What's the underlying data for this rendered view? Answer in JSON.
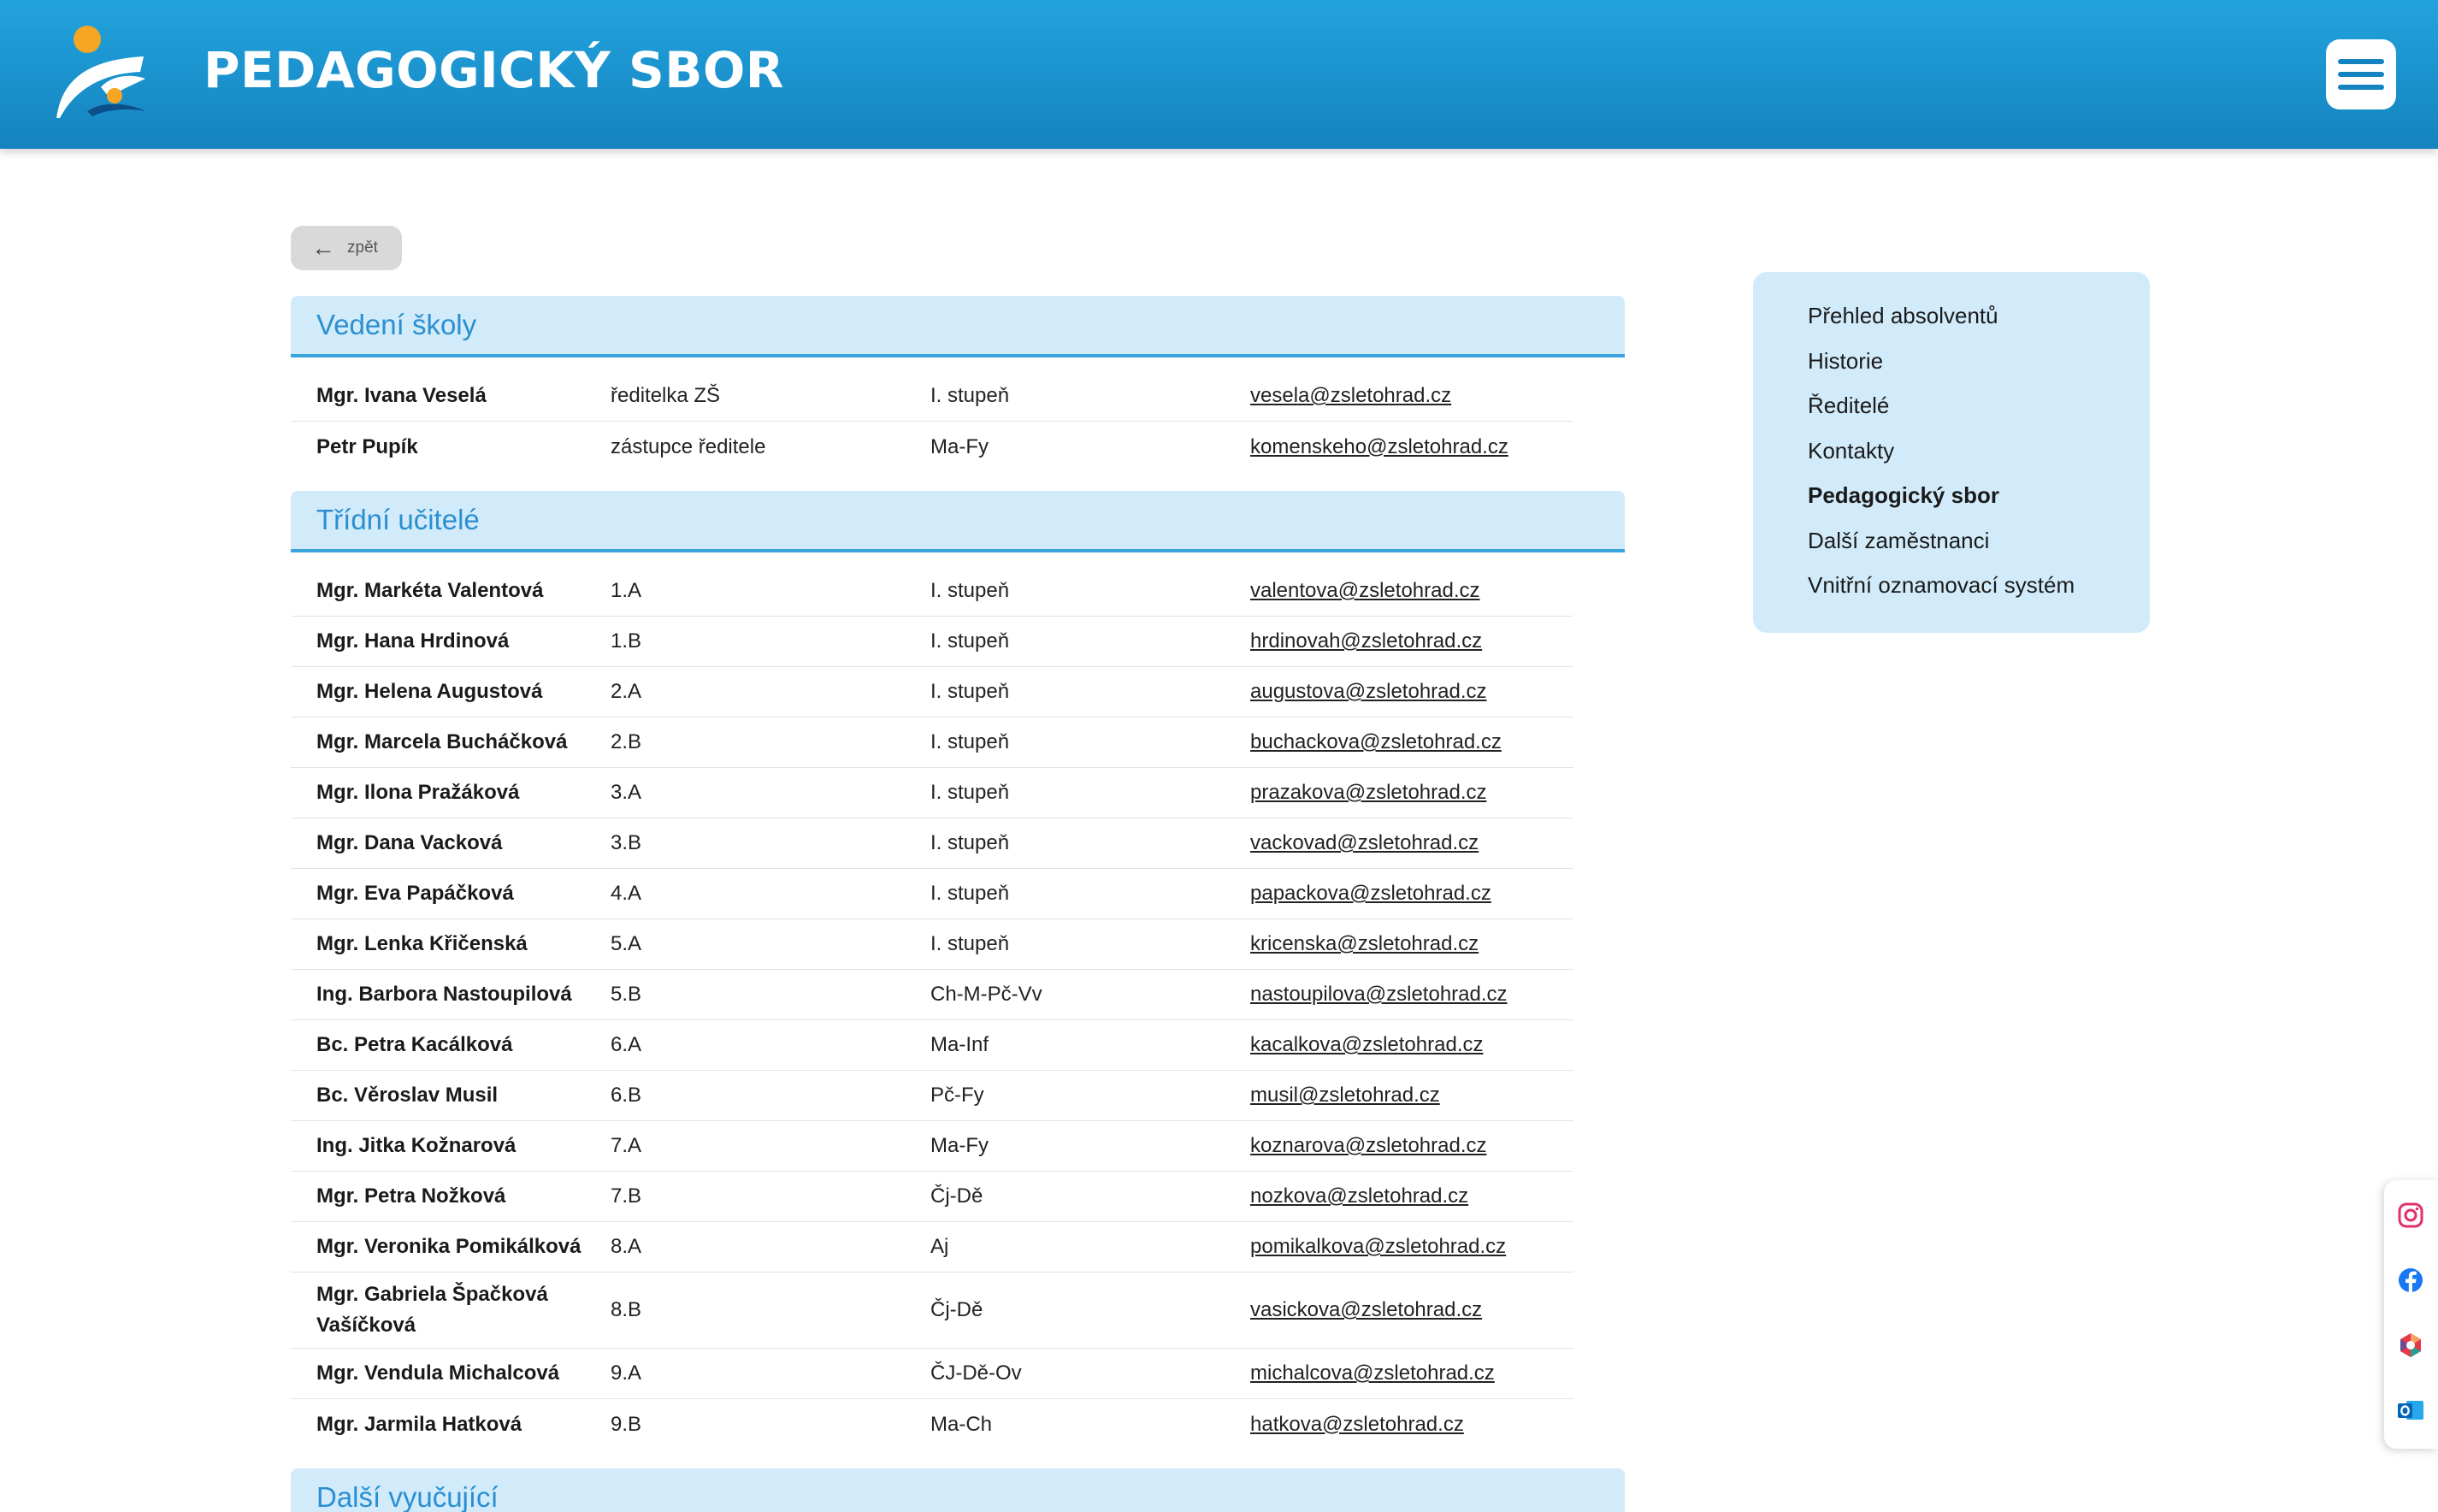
{
  "header": {
    "title": "PEDAGOGICKÝ SBOR",
    "colors": {
      "background": "#1b95d3",
      "logo_orange": "#f5a623",
      "logo_blue": "#1a6fb5"
    }
  },
  "back_button": {
    "label": "zpět"
  },
  "sections": [
    {
      "title": "Vedení školy",
      "rows": [
        {
          "name": "Mgr. Ivana Veselá",
          "role": "ředitelka ZŠ",
          "subject": " I. stupeň",
          "email": "vesela@zsletohrad.cz"
        },
        {
          "name": "Petr Pupík",
          "role": "zástupce ředitele",
          "subject": "Ma-Fy",
          "email": "komenskeho@zsletohrad.cz"
        }
      ]
    },
    {
      "title": "Třídní učitelé",
      "rows": [
        {
          "name": "Mgr. Markéta Valentová",
          "role": "1.A",
          "subject": "I. stupeň",
          "email": "valentova@zsletohrad.cz"
        },
        {
          "name": "Mgr. Hana Hrdinová",
          "role": "1.B",
          "subject": "I. stupeň",
          "email": "hrdinovah@zsletohrad.cz"
        },
        {
          "name": "Mgr. Helena Augustová",
          "role": "2.A",
          "subject": "I. stupeň",
          "email": "augustova@zsletohrad.cz"
        },
        {
          "name": "Mgr. Marcela Bucháčková",
          "role": "2.B",
          "subject": "I. stupeň",
          "email": "buchackova@zsletohrad.cz"
        },
        {
          "name": "Mgr. Ilona Pražáková",
          "role": "3.A",
          "subject": "I. stupeň",
          "email": "prazakova@zsletohrad.cz"
        },
        {
          "name": "Mgr. Dana Vacková",
          "role": "3.B",
          "subject": "I. stupeň",
          "email": "vackovad@zsletohrad.cz"
        },
        {
          "name": "Mgr. Eva Papáčková",
          "role": "4.A",
          "subject": "I. stupeň",
          "email": "papackova@zsletohrad.cz"
        },
        {
          "name": "Mgr. Lenka Křičenská",
          "role": "5.A",
          "subject": "I. stupeň",
          "email": "kricenska@zsletohrad.cz"
        },
        {
          "name": "Ing. Barbora Nastoupilová",
          "role": "5.B",
          "subject": "Ch-M-Pč-Vv",
          "email": "nastoupilova@zsletohrad.cz"
        },
        {
          "name": "Bc. Petra Kacálková",
          "role": "6.A",
          "subject": "Ma-Inf",
          "email": "kacalkova@zsletohrad.cz"
        },
        {
          "name": "Bc. Věroslav Musil",
          "role": "6.B",
          "subject": "Pč-Fy",
          "email": "musil@zsletohrad.cz"
        },
        {
          "name": "Ing. Jitka Kožnarová",
          "role": "7.A",
          "subject": "Ma-Fy",
          "email": "koznarova@zsletohrad.cz"
        },
        {
          "name": "Mgr. Petra Nožková",
          "role": "7.B",
          "subject": "Čj-Dě",
          "email": "nozkova@zsletohrad.cz"
        },
        {
          "name": "Mgr. Veronika Pomikálková",
          "role": "8.A",
          "subject": "Aj",
          "email": "pomikalkova@zsletohrad.cz"
        },
        {
          "name": "Mgr. Gabriela Špačková Vašíčková",
          "role": "8.B",
          "subject": "Čj-Dě",
          "email": "vasickova@zsletohrad.cz"
        },
        {
          "name": "Mgr. Vendula Michalcová",
          "role": "9.A",
          "subject": "ČJ-Dě-Ov",
          "email": "michalcova@zsletohrad.cz"
        },
        {
          "name": "Mgr. Jarmila Hatková",
          "role": "9.B",
          "subject": "Ma-Ch",
          "email": "hatkova@zsletohrad.cz"
        }
      ]
    }
  ],
  "next_section": {
    "title": "Další vyučující"
  },
  "sidenav": {
    "items": [
      {
        "label": "Přehled absolventů",
        "active": false
      },
      {
        "label": "Historie",
        "active": false
      },
      {
        "label": "Ředitelé",
        "active": false
      },
      {
        "label": "Kontakty",
        "active": false
      },
      {
        "label": "Pedagogický sbor",
        "active": true
      },
      {
        "label": "Další zaměstnanci",
        "active": false
      },
      {
        "label": "Vnitřní oznamovací systém",
        "active": false
      }
    ]
  },
  "social": {
    "icons": [
      "instagram-icon",
      "facebook-icon",
      "bakalari-icon",
      "outlook-icon"
    ]
  }
}
